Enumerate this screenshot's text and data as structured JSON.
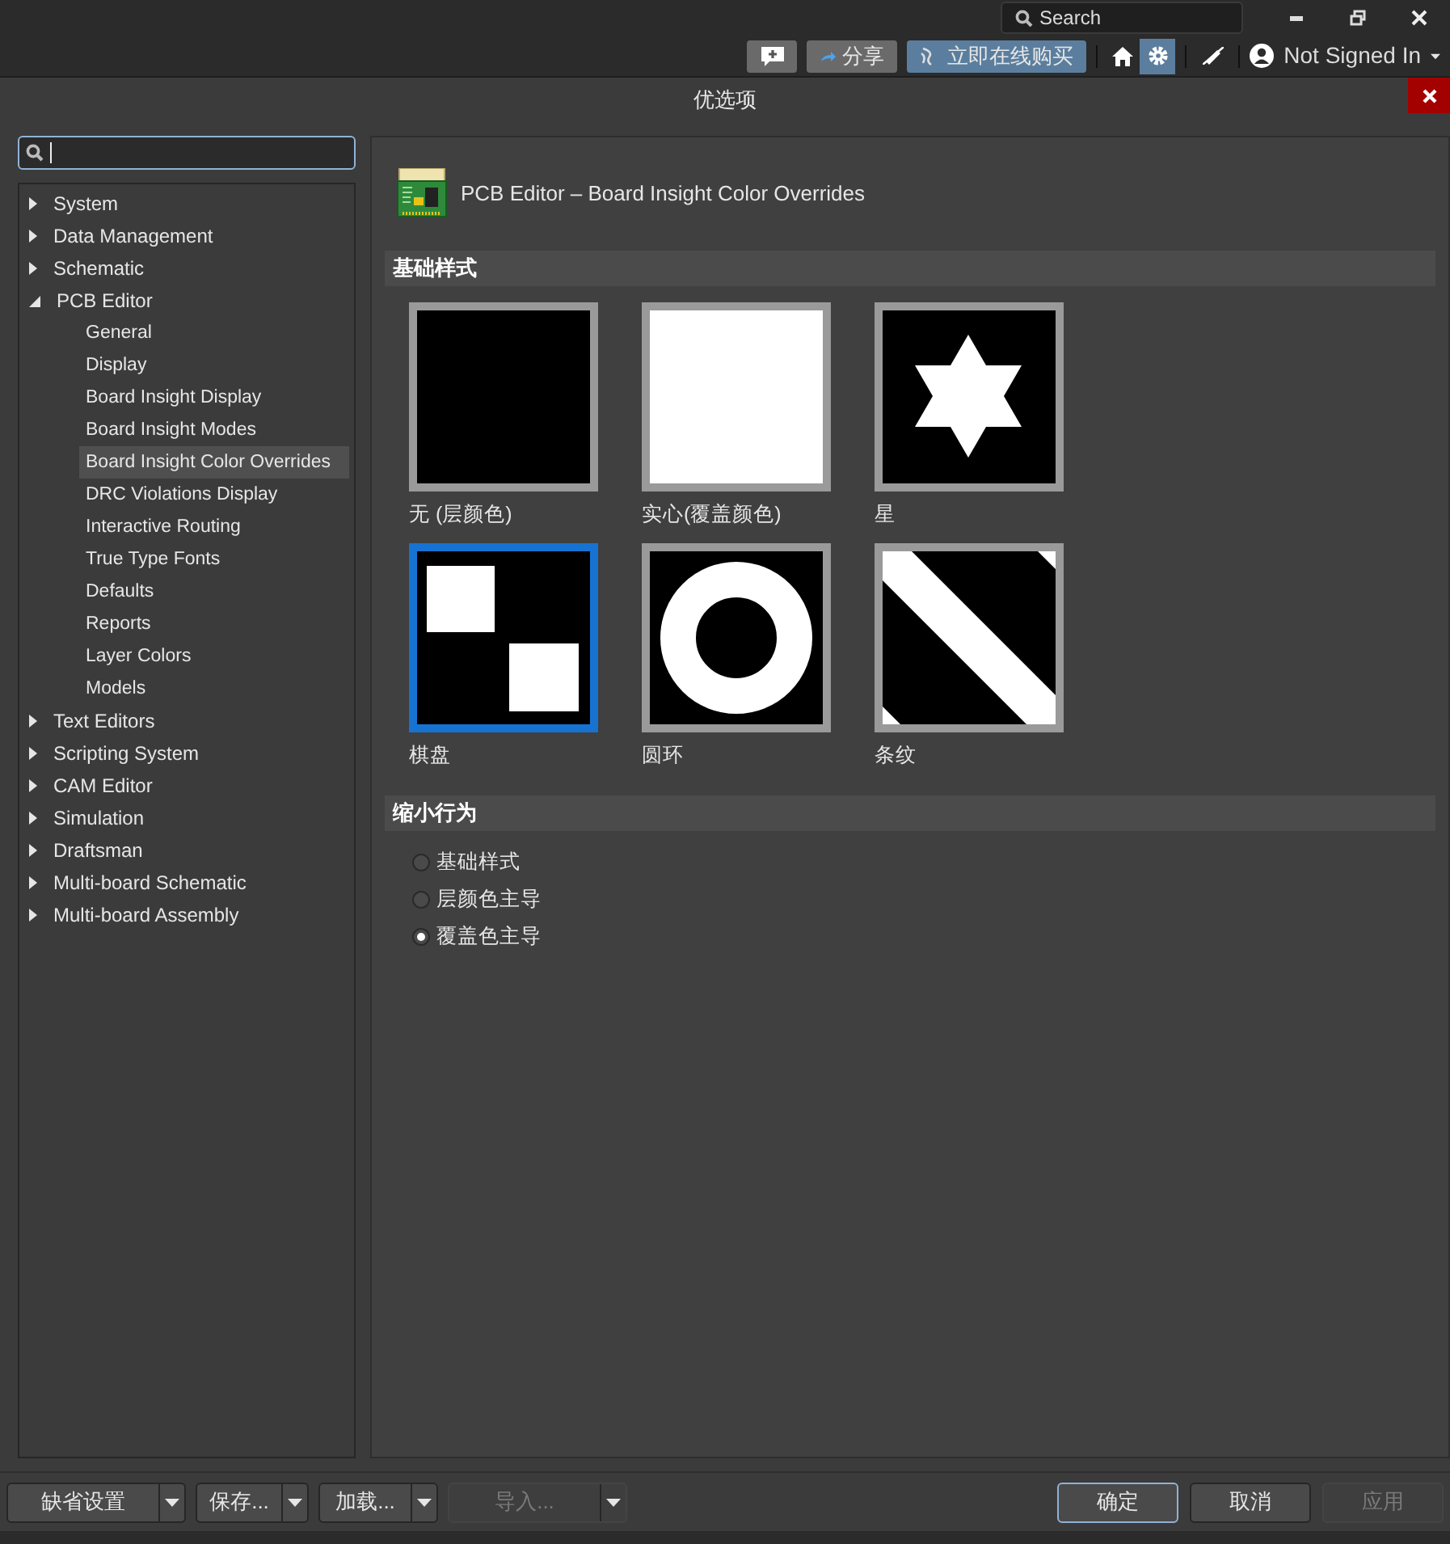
{
  "top_bar": {
    "search_placeholder": "Search"
  },
  "toolbar": {
    "share": "分享",
    "buy": "立即在线购买",
    "user": "Not Signed In"
  },
  "dialog": {
    "title": "优选项"
  },
  "tree": [
    {
      "label": "System",
      "expanded": false
    },
    {
      "label": "Data Management",
      "expanded": false
    },
    {
      "label": "Schematic",
      "expanded": false
    },
    {
      "label": "PCB Editor",
      "expanded": true,
      "children": [
        {
          "label": "General",
          "selected": false
        },
        {
          "label": "Display",
          "selected": false
        },
        {
          "label": "Board Insight Display",
          "selected": false
        },
        {
          "label": "Board Insight Modes",
          "selected": false
        },
        {
          "label": "Board Insight Color Overrides",
          "selected": true
        },
        {
          "label": "DRC Violations Display",
          "selected": false
        },
        {
          "label": "Interactive Routing",
          "selected": false
        },
        {
          "label": "True Type Fonts",
          "selected": false
        },
        {
          "label": "Defaults",
          "selected": false
        },
        {
          "label": "Reports",
          "selected": false
        },
        {
          "label": "Layer Colors",
          "selected": false
        },
        {
          "label": "Models",
          "selected": false
        }
      ]
    },
    {
      "label": "Text Editors",
      "expanded": false
    },
    {
      "label": "Scripting System",
      "expanded": false
    },
    {
      "label": "CAM Editor",
      "expanded": false
    },
    {
      "label": "Simulation",
      "expanded": false
    },
    {
      "label": "Draftsman",
      "expanded": false
    },
    {
      "label": "Multi-board Schematic",
      "expanded": false
    },
    {
      "label": "Multi-board Assembly",
      "expanded": false
    }
  ],
  "page": {
    "title": "PCB Editor – Board Insight Color Overrides",
    "base_pattern": {
      "heading": "基础样式",
      "options": [
        {
          "kind": "none",
          "label": "无 (层颜色)",
          "selected": false
        },
        {
          "kind": "solid",
          "label": "实心(覆盖颜色)",
          "selected": false
        },
        {
          "kind": "star",
          "label": "星",
          "selected": false
        },
        {
          "kind": "checker",
          "label": "棋盘",
          "selected": true
        },
        {
          "kind": "ring",
          "label": "圆环",
          "selected": false
        },
        {
          "kind": "stripe",
          "label": "条纹",
          "selected": false
        }
      ]
    },
    "zoom_behavior": {
      "heading": "缩小行为",
      "options": [
        {
          "label": "基础样式",
          "selected": false
        },
        {
          "label": "层颜色主导",
          "selected": false
        },
        {
          "label": "覆盖色主导",
          "selected": true
        }
      ]
    }
  },
  "footer": {
    "left": [
      {
        "label": "缺省设置",
        "disabled": false
      },
      {
        "label": "保存...",
        "disabled": false
      },
      {
        "label": "加载...",
        "disabled": false
      },
      {
        "label": "导入...",
        "disabled": true
      }
    ],
    "right": [
      {
        "label": "确定",
        "default": true,
        "disabled": false
      },
      {
        "label": "取消",
        "default": false,
        "disabled": false
      },
      {
        "label": "应用",
        "default": false,
        "disabled": true
      }
    ]
  }
}
